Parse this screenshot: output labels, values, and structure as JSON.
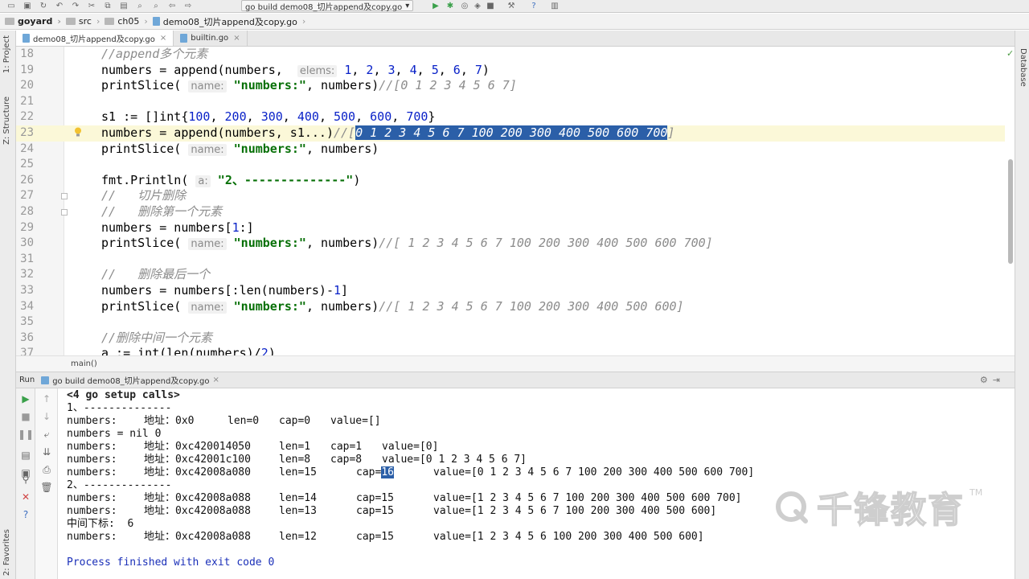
{
  "run_config": {
    "label": "go build demo08_切片append及copy.go"
  },
  "breadcrumb": [
    "goyard",
    "src",
    "ch05",
    "demo08_切片append及copy.go"
  ],
  "tabs": [
    {
      "label": "demo08_切片append及copy.go",
      "active": true
    },
    {
      "label": "builtin.go",
      "active": false
    }
  ],
  "sidebar_left": {
    "project": "1: Project",
    "structure": "Z: Structure",
    "favorites": "2: Favorites"
  },
  "sidebar_right": {
    "database": "Database"
  },
  "editor": {
    "current_line": 23,
    "lines": [
      {
        "n": "18",
        "segs": [
          [
            "cmt",
            "//append多个元素"
          ]
        ]
      },
      {
        "n": "19",
        "segs": [
          [
            "kw",
            "numbers = append(numbers,  "
          ],
          [
            "hint",
            "elems:"
          ],
          [
            "kw",
            " "
          ],
          [
            "num",
            "1"
          ],
          [
            "kw",
            ", "
          ],
          [
            "num",
            "2"
          ],
          [
            "kw",
            ", "
          ],
          [
            "num",
            "3"
          ],
          [
            "kw",
            ", "
          ],
          [
            "num",
            "4"
          ],
          [
            "kw",
            ", "
          ],
          [
            "num",
            "5"
          ],
          [
            "kw",
            ", "
          ],
          [
            "num",
            "6"
          ],
          [
            "kw",
            ", "
          ],
          [
            "num",
            "7"
          ],
          [
            "kw",
            ")"
          ]
        ]
      },
      {
        "n": "20",
        "segs": [
          [
            "kw",
            "printSlice( "
          ],
          [
            "hint",
            "name:"
          ],
          [
            "kw",
            " "
          ],
          [
            "str",
            "\"numbers:\""
          ],
          [
            "kw",
            ", numbers)"
          ],
          [
            "cmt",
            "//[0 1 2 3 4 5 6 7]"
          ]
        ]
      },
      {
        "n": "21",
        "segs": []
      },
      {
        "n": "22",
        "segs": [
          [
            "kw",
            "s1 := []int{"
          ],
          [
            "num",
            "100"
          ],
          [
            "kw",
            ", "
          ],
          [
            "num",
            "200"
          ],
          [
            "kw",
            ", "
          ],
          [
            "num",
            "300"
          ],
          [
            "kw",
            ", "
          ],
          [
            "num",
            "400"
          ],
          [
            "kw",
            ", "
          ],
          [
            "num",
            "500"
          ],
          [
            "kw",
            ", "
          ],
          [
            "num",
            "600"
          ],
          [
            "kw",
            ", "
          ],
          [
            "num",
            "700"
          ],
          [
            "kw",
            "}"
          ]
        ]
      },
      {
        "n": "23",
        "segs": [
          [
            "kw",
            "numbers = append(numbers, s1...)"
          ],
          [
            "cmt",
            "//["
          ],
          [
            "sel",
            "0 1 2 3 4 5 6 7 100 200 300 400 500 600 700"
          ],
          [
            "cmt",
            "]"
          ]
        ]
      },
      {
        "n": "24",
        "segs": [
          [
            "kw",
            "printSlice( "
          ],
          [
            "hint",
            "name:"
          ],
          [
            "kw",
            " "
          ],
          [
            "str",
            "\"numbers:\""
          ],
          [
            "kw",
            ", numbers)"
          ]
        ]
      },
      {
        "n": "25",
        "segs": []
      },
      {
        "n": "26",
        "segs": [
          [
            "kw",
            "fmt.Println( "
          ],
          [
            "hint",
            "a:"
          ],
          [
            "kw",
            " "
          ],
          [
            "str",
            "\"2、--------------\""
          ],
          [
            "kw",
            ")"
          ]
        ]
      },
      {
        "n": "27",
        "segs": [
          [
            "cmt",
            "//   切片删除"
          ]
        ]
      },
      {
        "n": "28",
        "segs": [
          [
            "cmt",
            "//   删除第一个元素"
          ]
        ]
      },
      {
        "n": "29",
        "segs": [
          [
            "kw",
            "numbers = numbers["
          ],
          [
            "num",
            "1"
          ],
          [
            "kw",
            ":]"
          ]
        ]
      },
      {
        "n": "30",
        "segs": [
          [
            "kw",
            "printSlice( "
          ],
          [
            "hint",
            "name:"
          ],
          [
            "kw",
            " "
          ],
          [
            "str",
            "\"numbers:\""
          ],
          [
            "kw",
            ", numbers)"
          ],
          [
            "cmt",
            "//[ 1 2 3 4 5 6 7 100 200 300 400 500 600 700]"
          ]
        ]
      },
      {
        "n": "31",
        "segs": []
      },
      {
        "n": "32",
        "segs": [
          [
            "cmt",
            "//   删除最后一个"
          ]
        ]
      },
      {
        "n": "33",
        "segs": [
          [
            "kw",
            "numbers = numbers[:len(numbers)-"
          ],
          [
            "num",
            "1"
          ],
          [
            "kw",
            "]"
          ]
        ]
      },
      {
        "n": "34",
        "segs": [
          [
            "kw",
            "printSlice( "
          ],
          [
            "hint",
            "name:"
          ],
          [
            "kw",
            " "
          ],
          [
            "str",
            "\"numbers:\""
          ],
          [
            "kw",
            ", numbers)"
          ],
          [
            "cmt",
            "//[ 1 2 3 4 5 6 7 100 200 300 400 500 600]"
          ]
        ]
      },
      {
        "n": "35",
        "segs": []
      },
      {
        "n": "36",
        "segs": [
          [
            "cmt",
            "//删除中间一个元素"
          ]
        ]
      },
      {
        "n": "37",
        "segs": [
          [
            "kw",
            "a := int(len(numbers)/"
          ],
          [
            "num",
            "2"
          ],
          [
            "kw",
            ")"
          ]
        ]
      }
    ]
  },
  "editor_breadcrumb": "main()",
  "run_panel": {
    "label": "Run",
    "tab": "go build demo08_切片append及copy.go"
  },
  "console": {
    "setup": "<4 go setup calls>",
    "lines": [
      {
        "t": "text",
        "s": "1、--------------"
      },
      {
        "t": "row",
        "a": "numbers:",
        "b": "地址：0x0",
        "c": "len=0",
        "d": "cap=0",
        "e": "value=[]",
        "layout": "short"
      },
      {
        "t": "text",
        "s": "numbers = nil 0"
      },
      {
        "t": "row",
        "a": "numbers:",
        "b": "地址：0xc420014050",
        "c": "len=1",
        "d": "cap=1",
        "e": "value=[0]",
        "layout": "mid"
      },
      {
        "t": "row",
        "a": "numbers:",
        "b": "地址：0xc42001c100",
        "c": "len=8",
        "d": "cap=8",
        "e": "value=[0 1 2 3 4 5 6 7]",
        "layout": "mid"
      },
      {
        "t": "row",
        "a": "numbers:",
        "b": "地址：0xc42008a080",
        "c": "len=15",
        "d": "cap=",
        "dh": "16",
        "e": "value=[0 1 2 3 4 5 6 7 100 200 300 400 500 600 700]",
        "layout": "wide"
      },
      {
        "t": "text",
        "s": "2、--------------"
      },
      {
        "t": "row",
        "a": "numbers:",
        "b": "地址：0xc42008a088",
        "c": "len=14",
        "d": "cap=15",
        "e": "value=[1 2 3 4 5 6 7 100 200 300 400 500 600 700]",
        "layout": "wide"
      },
      {
        "t": "row",
        "a": "numbers:",
        "b": "地址：0xc42008a088",
        "c": "len=13",
        "d": "cap=15",
        "e": "value=[1 2 3 4 5 6 7 100 200 300 400 500 600]",
        "layout": "wide"
      },
      {
        "t": "text",
        "s": "中间下标:  6"
      },
      {
        "t": "row",
        "a": "numbers:",
        "b": "地址：0xc42008a088",
        "c": "len=12",
        "d": "cap=15",
        "e": "value=[1 2 3 4 5 6 100 200 300 400 500 600]",
        "layout": "wide"
      },
      {
        "t": "text",
        "s": ""
      },
      {
        "t": "blue",
        "s": "Process finished with exit code 0"
      }
    ]
  },
  "watermark": {
    "text": "千锋教育",
    "tm": "TM"
  },
  "colors": {
    "selection": "#2b5fa8",
    "string": "#077007",
    "number": "#0a22c8",
    "comment": "#8c8c8c",
    "current_line": "#fbf8d8"
  }
}
